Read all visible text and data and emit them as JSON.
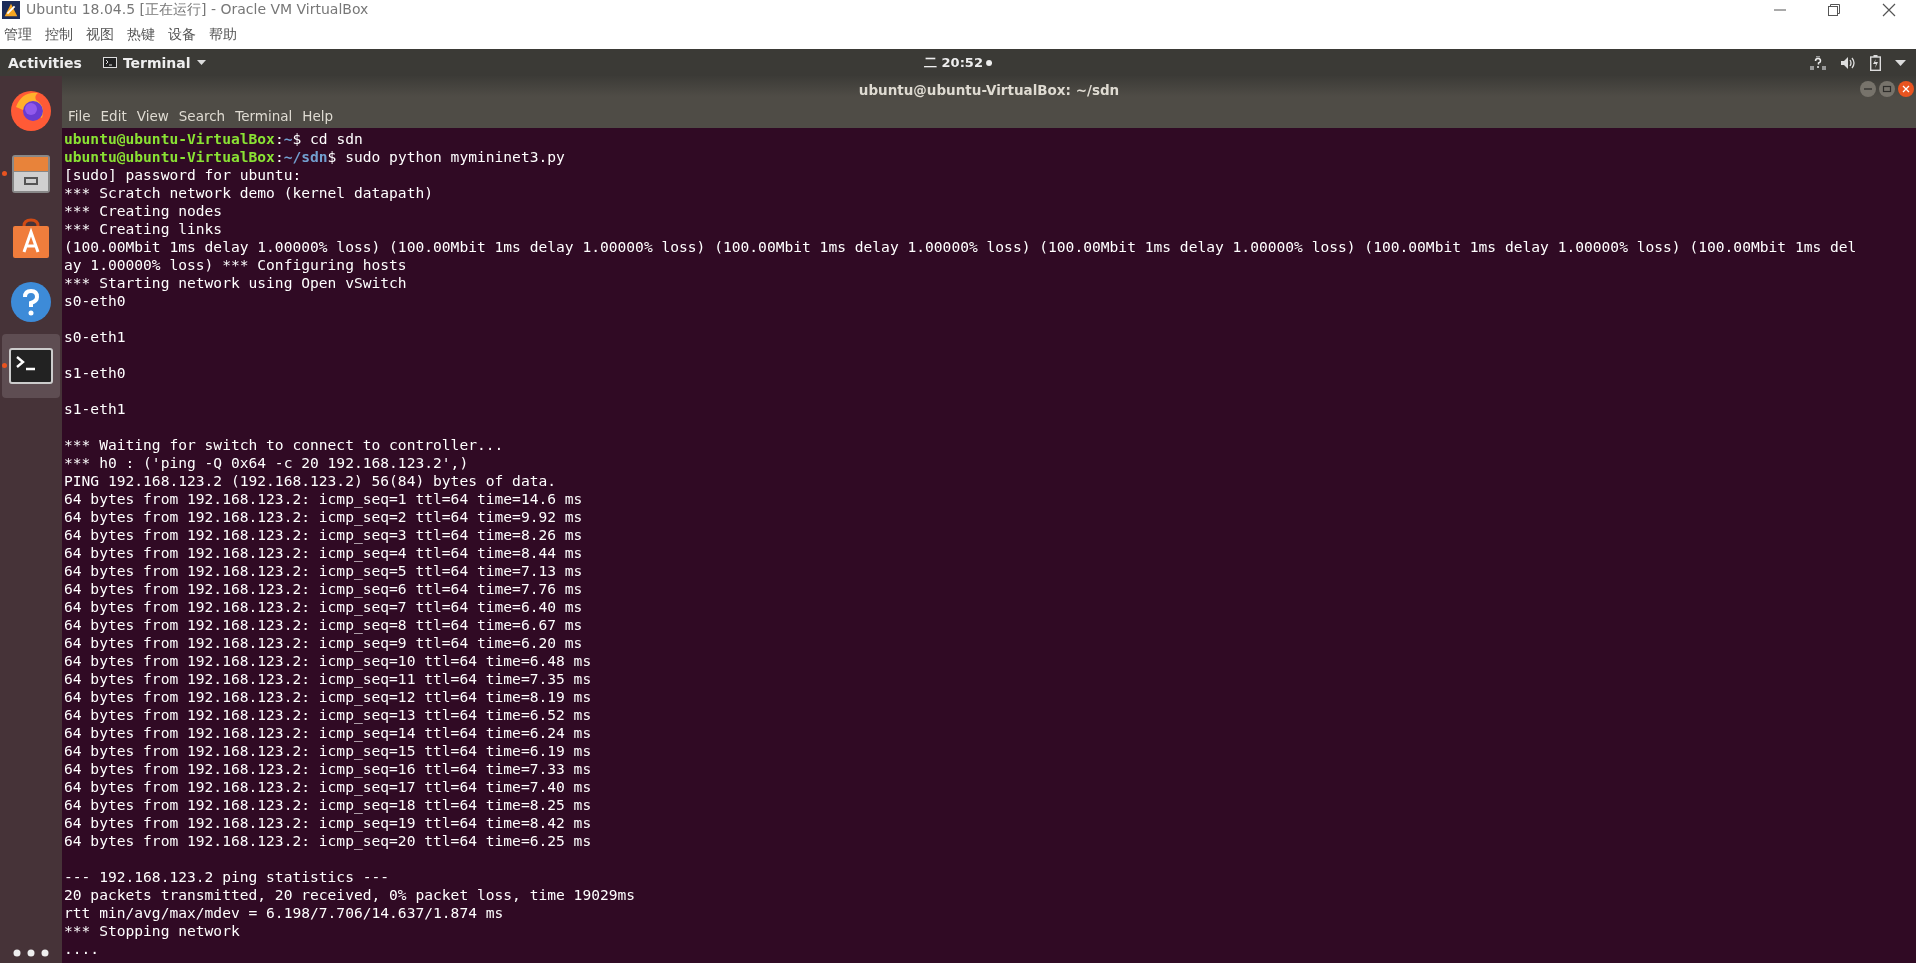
{
  "host_window": {
    "title": "Ubuntu 18.04.5 [正在运行] - Oracle VM VirtualBox",
    "menu": [
      "管理",
      "控制",
      "视图",
      "热键",
      "设备",
      "帮助"
    ]
  },
  "top_bar": {
    "activities": "Activities",
    "app_menu": "Terminal",
    "clock": "二 20:52"
  },
  "dock": {
    "items": [
      {
        "kind": "browser",
        "running": false
      },
      {
        "kind": "files",
        "running": true
      },
      {
        "kind": "software",
        "running": false
      },
      {
        "kind": "help",
        "running": false
      },
      {
        "kind": "terminal",
        "running": true,
        "selected": true
      }
    ]
  },
  "terminal": {
    "title": "ubuntu@ubuntu-VirtualBox: ~/sdn",
    "menu": [
      "File",
      "Edit",
      "View",
      "Search",
      "Terminal",
      "Help"
    ],
    "lines": [
      {
        "kind": "prompt",
        "user": "ubuntu@ubuntu-VirtualBox",
        "separator": ":",
        "path": "~",
        "command": "$ cd sdn"
      },
      {
        "kind": "prompt",
        "user": "ubuntu@ubuntu-VirtualBox",
        "separator": ":",
        "path": "~/sdn",
        "command": "$ sudo python mymininet3.py"
      },
      {
        "kind": "output",
        "text": "[sudo] password for ubuntu:"
      },
      {
        "kind": "output",
        "text": "*** Scratch network demo (kernel datapath)"
      },
      {
        "kind": "output",
        "text": "*** Creating nodes"
      },
      {
        "kind": "output",
        "text": "*** Creating links"
      },
      {
        "kind": "output",
        "text": "(100.00Mbit 1ms delay 1.00000% loss) (100.00Mbit 1ms delay 1.00000% loss) (100.00Mbit 1ms delay 1.00000% loss) (100.00Mbit 1ms delay 1.00000% loss) (100.00Mbit 1ms delay 1.00000% loss) (100.00Mbit 1ms del"
      },
      {
        "kind": "output",
        "text": "ay 1.00000% loss) *** Configuring hosts"
      },
      {
        "kind": "output",
        "text": "*** Starting network using Open vSwitch"
      },
      {
        "kind": "output",
        "text": "s0-eth0",
        "blank_after": true
      },
      {
        "kind": "output",
        "text": "s0-eth1",
        "blank_after": true
      },
      {
        "kind": "output",
        "text": "s1-eth0",
        "blank_after": true
      },
      {
        "kind": "output",
        "text": "s1-eth1",
        "blank_after": true
      },
      {
        "kind": "output",
        "text": "*** Waiting for switch to connect to controller..."
      },
      {
        "kind": "output",
        "text": "*** h0 : ('ping -Q 0x64 -c 20 192.168.123.2',)"
      },
      {
        "kind": "output",
        "text": "PING 192.168.123.2 (192.168.123.2) 56(84) bytes of data."
      },
      {
        "kind": "output",
        "text": "64 bytes from 192.168.123.2: icmp_seq=1 ttl=64 time=14.6 ms"
      },
      {
        "kind": "output",
        "text": "64 bytes from 192.168.123.2: icmp_seq=2 ttl=64 time=9.92 ms"
      },
      {
        "kind": "output",
        "text": "64 bytes from 192.168.123.2: icmp_seq=3 ttl=64 time=8.26 ms"
      },
      {
        "kind": "output",
        "text": "64 bytes from 192.168.123.2: icmp_seq=4 ttl=64 time=8.44 ms"
      },
      {
        "kind": "output",
        "text": "64 bytes from 192.168.123.2: icmp_seq=5 ttl=64 time=7.13 ms"
      },
      {
        "kind": "output",
        "text": "64 bytes from 192.168.123.2: icmp_seq=6 ttl=64 time=7.76 ms"
      },
      {
        "kind": "output",
        "text": "64 bytes from 192.168.123.2: icmp_seq=7 ttl=64 time=6.40 ms"
      },
      {
        "kind": "output",
        "text": "64 bytes from 192.168.123.2: icmp_seq=8 ttl=64 time=6.67 ms"
      },
      {
        "kind": "output",
        "text": "64 bytes from 192.168.123.2: icmp_seq=9 ttl=64 time=6.20 ms"
      },
      {
        "kind": "output",
        "text": "64 bytes from 192.168.123.2: icmp_seq=10 ttl=64 time=6.48 ms"
      },
      {
        "kind": "output",
        "text": "64 bytes from 192.168.123.2: icmp_seq=11 ttl=64 time=7.35 ms"
      },
      {
        "kind": "output",
        "text": "64 bytes from 192.168.123.2: icmp_seq=12 ttl=64 time=8.19 ms"
      },
      {
        "kind": "output",
        "text": "64 bytes from 192.168.123.2: icmp_seq=13 ttl=64 time=6.52 ms"
      },
      {
        "kind": "output",
        "text": "64 bytes from 192.168.123.2: icmp_seq=14 ttl=64 time=6.24 ms"
      },
      {
        "kind": "output",
        "text": "64 bytes from 192.168.123.2: icmp_seq=15 ttl=64 time=6.19 ms"
      },
      {
        "kind": "output",
        "text": "64 bytes from 192.168.123.2: icmp_seq=16 ttl=64 time=7.33 ms"
      },
      {
        "kind": "output",
        "text": "64 bytes from 192.168.123.2: icmp_seq=17 ttl=64 time=7.40 ms"
      },
      {
        "kind": "output",
        "text": "64 bytes from 192.168.123.2: icmp_seq=18 ttl=64 time=8.25 ms"
      },
      {
        "kind": "output",
        "text": "64 bytes from 192.168.123.2: icmp_seq=19 ttl=64 time=8.42 ms"
      },
      {
        "kind": "output",
        "text": "64 bytes from 192.168.123.2: icmp_seq=20 ttl=64 time=6.25 ms",
        "blank_after": true
      },
      {
        "kind": "output",
        "text": "--- 192.168.123.2 ping statistics ---"
      },
      {
        "kind": "output",
        "text": "20 packets transmitted, 20 received, 0% packet loss, time 19029ms"
      },
      {
        "kind": "output",
        "text": "rtt min/avg/max/mdev = 6.198/7.706/14.637/1.874 ms"
      },
      {
        "kind": "output",
        "text": "*** Stopping network"
      },
      {
        "kind": "output",
        "text": "...."
      }
    ]
  }
}
